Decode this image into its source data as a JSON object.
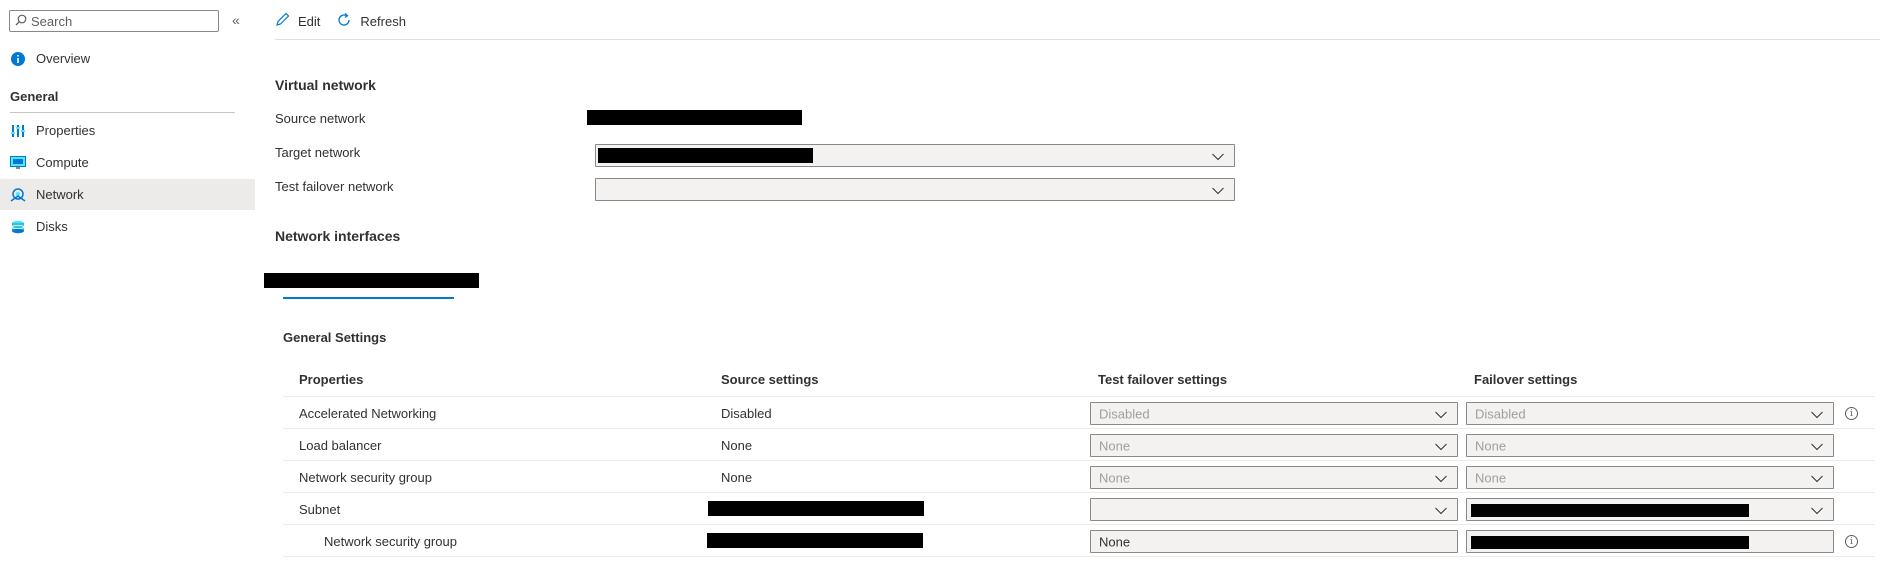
{
  "sidebar": {
    "search_placeholder": "Search",
    "collapse_glyph": "«",
    "overview_label": "Overview",
    "section_label": "General",
    "items": [
      {
        "label": "Properties",
        "icon": "properties-icon"
      },
      {
        "label": "Compute",
        "icon": "compute-icon"
      },
      {
        "label": "Network",
        "icon": "network-icon",
        "selected": true
      },
      {
        "label": "Disks",
        "icon": "disks-icon"
      }
    ]
  },
  "toolbar": {
    "edit_label": "Edit",
    "refresh_label": "Refresh"
  },
  "virtual_network": {
    "heading": "Virtual network",
    "source_label": "Source network",
    "target_label": "Target network",
    "test_failover_label": "Test failover network"
  },
  "network_interfaces": {
    "heading": "Network interfaces"
  },
  "general_settings": {
    "heading": "General Settings",
    "columns": [
      "Properties",
      "Source settings",
      "Test failover settings",
      "Failover settings"
    ],
    "rows": [
      {
        "property": "Accelerated Networking",
        "source": "Disabled",
        "test_failover": "Disabled",
        "failover": "Disabled"
      },
      {
        "property": "Load balancer",
        "source": "None",
        "test_failover": "None",
        "failover": "None"
      },
      {
        "property": "Network security group",
        "source": "None",
        "test_failover": "None",
        "failover": "None"
      },
      {
        "property": "Subnet",
        "source": "",
        "test_failover": "",
        "failover": ""
      },
      {
        "property": "Network security group",
        "source": "",
        "test_failover": "None",
        "failover": ""
      }
    ]
  },
  "colors": {
    "accent": "#0078d4",
    "selected_bg": "#edebe9",
    "redaction": "#000000"
  }
}
